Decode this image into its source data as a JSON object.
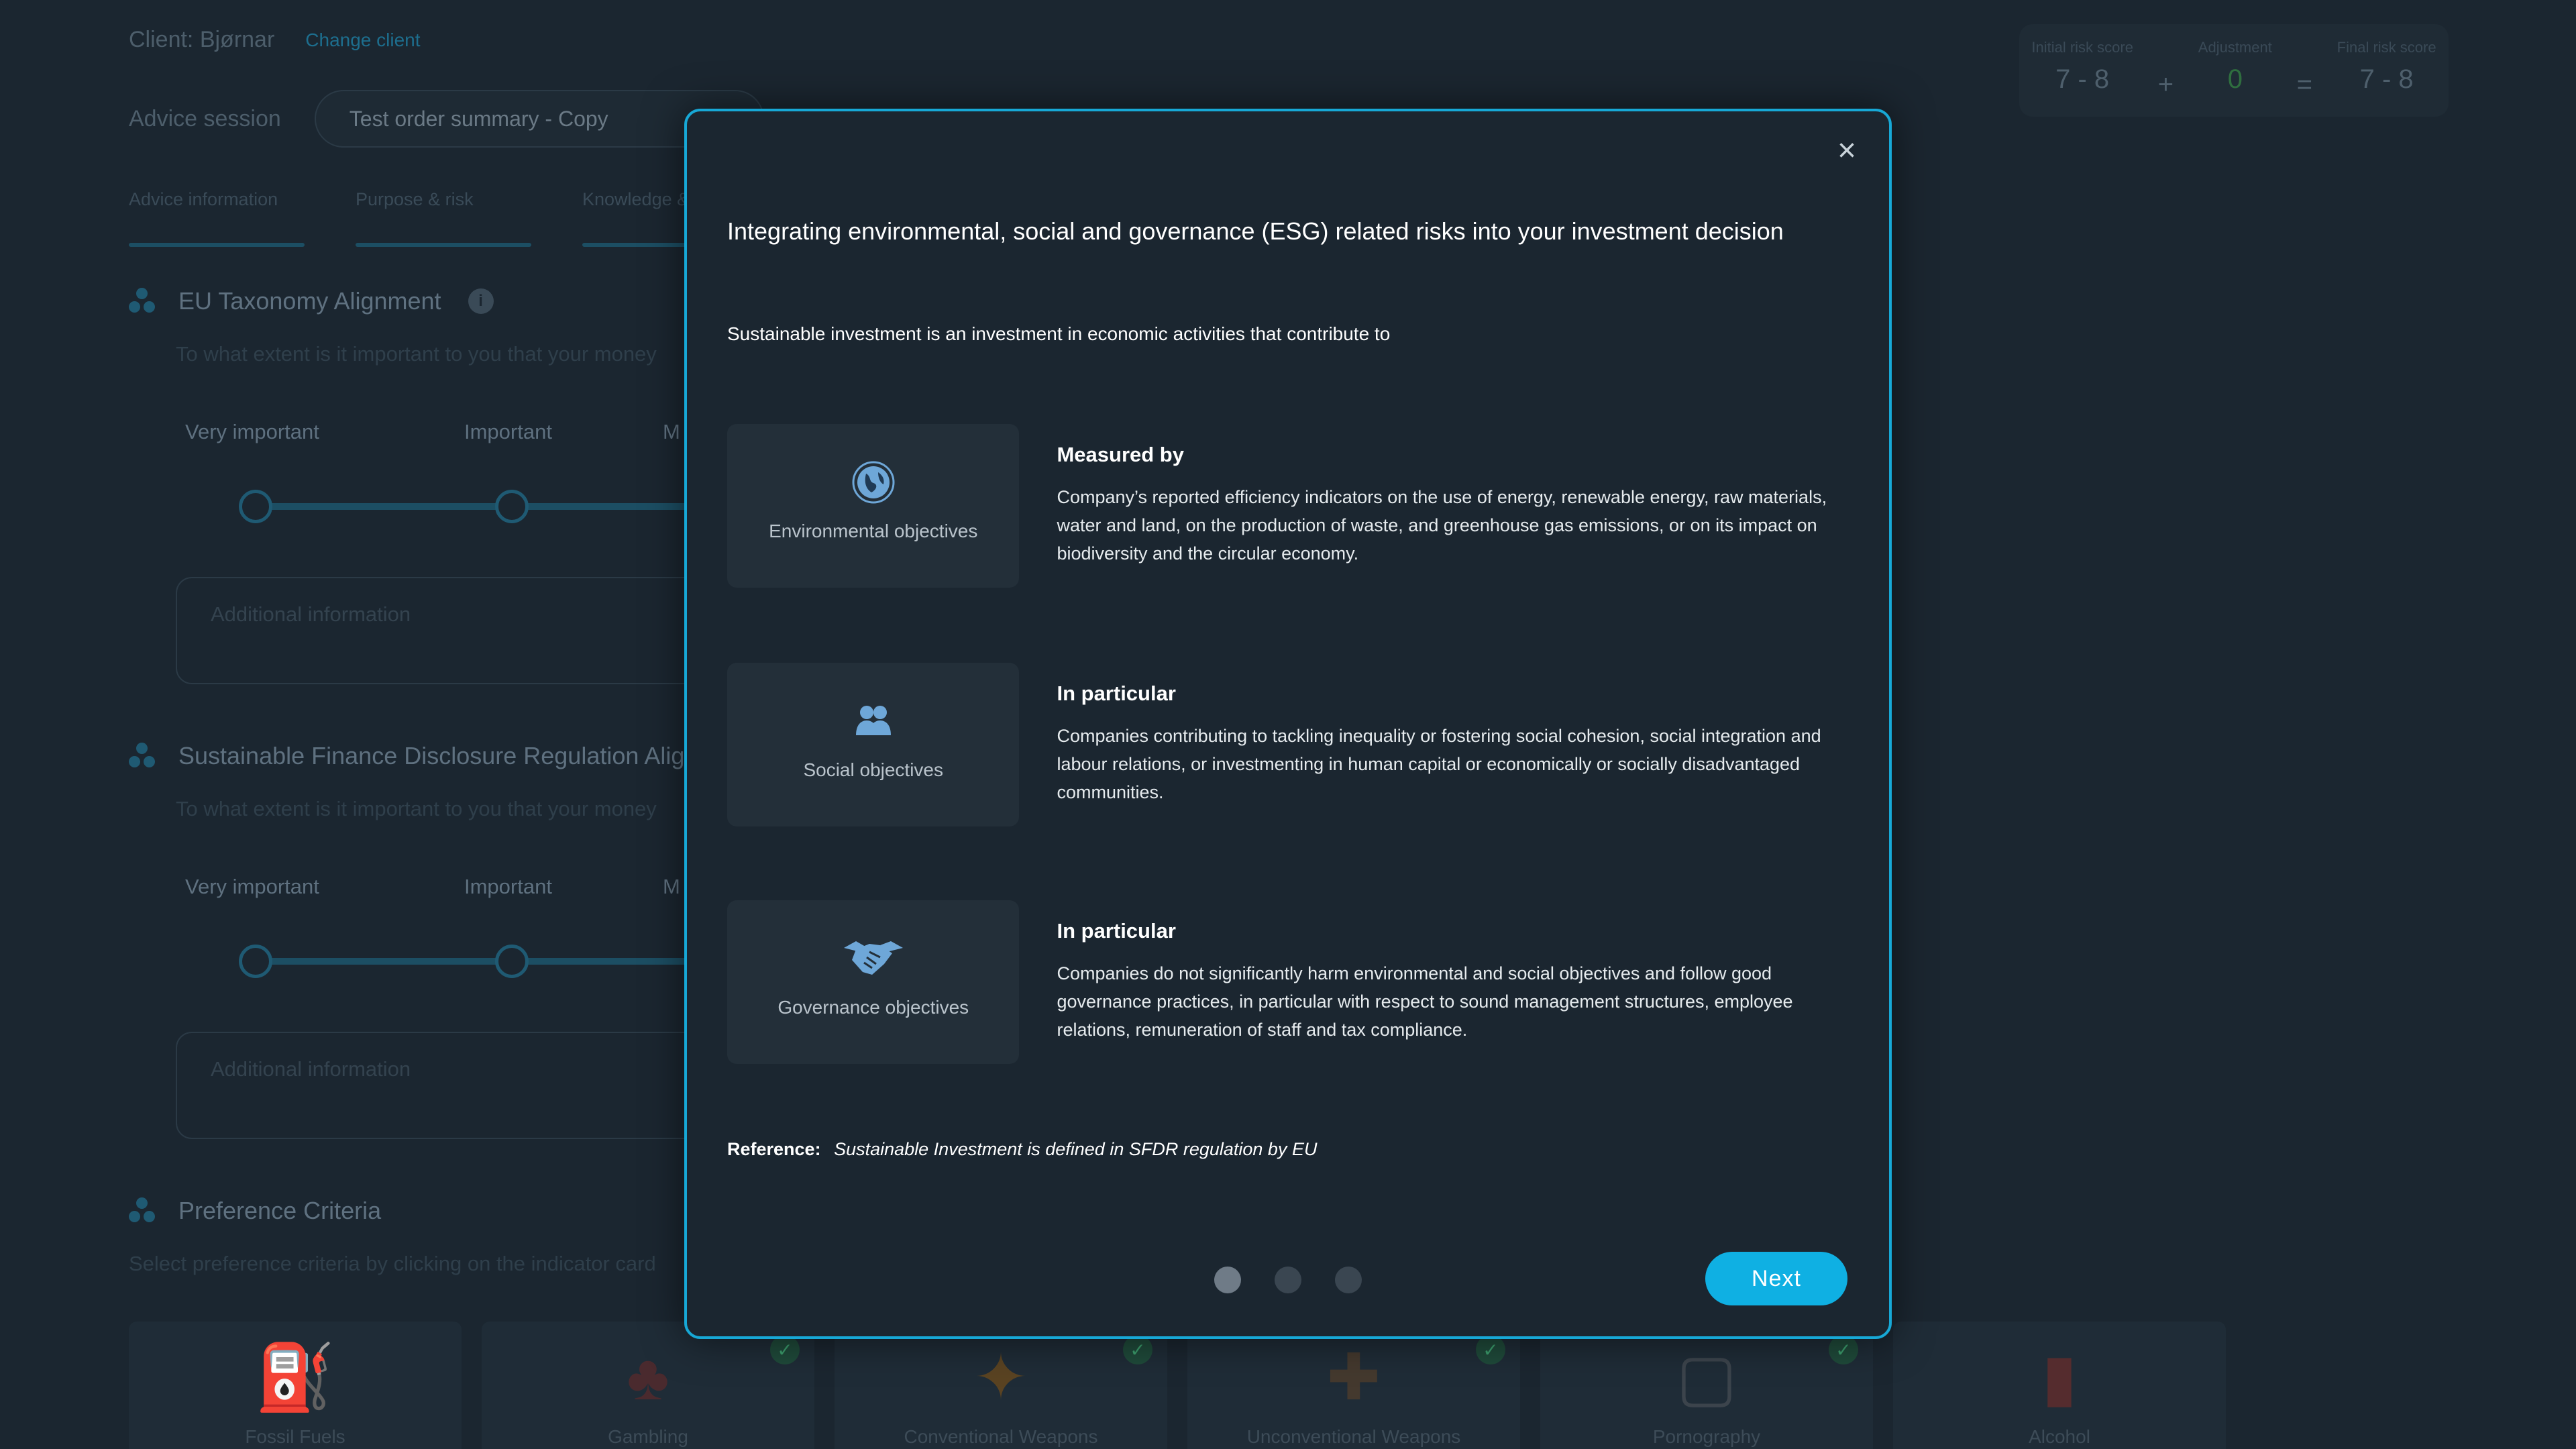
{
  "client": {
    "label": "Client: Bjørnar",
    "change_link": "Change client"
  },
  "session": {
    "label": "Advice session",
    "value": "Test order summary - Copy"
  },
  "tabs": [
    {
      "label": "Advice information"
    },
    {
      "label": "Purpose & risk"
    },
    {
      "label": "Knowledge & e"
    }
  ],
  "risk": {
    "initial_label": "Initial risk score",
    "initial_value": "7 - 8",
    "plus": "+",
    "adjustment_label": "Adjustment",
    "adjustment_value": "0",
    "equals": "=",
    "final_label": "Final risk score",
    "final_value": "7 - 8"
  },
  "sections": [
    {
      "title": "EU Taxonomy Alignment",
      "subtitle": "To what extent is it important to you that your money",
      "scale": [
        "Very important",
        "Important",
        "M"
      ],
      "additional_placeholder": "Additional information"
    },
    {
      "title": "Sustainable Finance Disclosure Regulation Alig",
      "subtitle": "To what extent is it important to you that your money",
      "scale": [
        "Very important",
        "Important",
        "M"
      ],
      "additional_placeholder": "Additional information"
    }
  ],
  "preference": {
    "title": "Preference Criteria",
    "subtitle": "Select preference criteria by clicking on the indicator card",
    "cards": [
      {
        "label": "Fossil Fuels",
        "icon": "oil-rig-icon",
        "checked": false
      },
      {
        "label": "Gambling",
        "icon": "card-suits-icon",
        "checked": true
      },
      {
        "label": "Conventional Weapons",
        "icon": "bomb-icon",
        "checked": true
      },
      {
        "label": "Unconventional Weapons",
        "icon": "rifle-icon",
        "checked": true
      },
      {
        "label": "Pornography",
        "icon": "xxx-laptop-icon",
        "checked": true
      },
      {
        "label": "Alcohol",
        "icon": "bottle-icon",
        "checked": false
      }
    ]
  },
  "modal": {
    "close": "×",
    "title": "Integrating environmental, social and governance (ESG) related risks into your investment decision",
    "intro": "Sustainable investment is an investment in economic activities that contribute to",
    "objectives": [
      {
        "icon": "globe-leaf-icon",
        "label": "Environmental objectives",
        "heading": "Measured by",
        "body": "Company’s reported efficiency indicators on the use of energy, renewable energy, raw materials, water and land, on the production of waste, and greenhouse gas emissions, or on its impact on biodiversity and the circular economy."
      },
      {
        "icon": "people-icon",
        "label": "Social objectives",
        "heading": "In particular",
        "body": "Companies contributing to tackling inequality or fostering social cohesion, social integration and labour relations, or investmenting in human capital or economically or socially disadvantaged communities."
      },
      {
        "icon": "handshake-icon",
        "label": "Governance objectives",
        "heading": "In particular",
        "body": "Companies do not significantly harm environmental and social objectives and follow good governance practices, in particular with respect to sound management structures, employee relations, remuneration of staff and tax compliance."
      }
    ],
    "reference_label": "Reference:",
    "reference_text": "Sustainable Investment is defined in SFDR regulation by EU",
    "pages": 3,
    "active_page": 1,
    "next_label": "Next"
  },
  "colors": {
    "accent": "#0fb0e3",
    "modal_border": "#17a8d6",
    "background": "#1b2630"
  }
}
